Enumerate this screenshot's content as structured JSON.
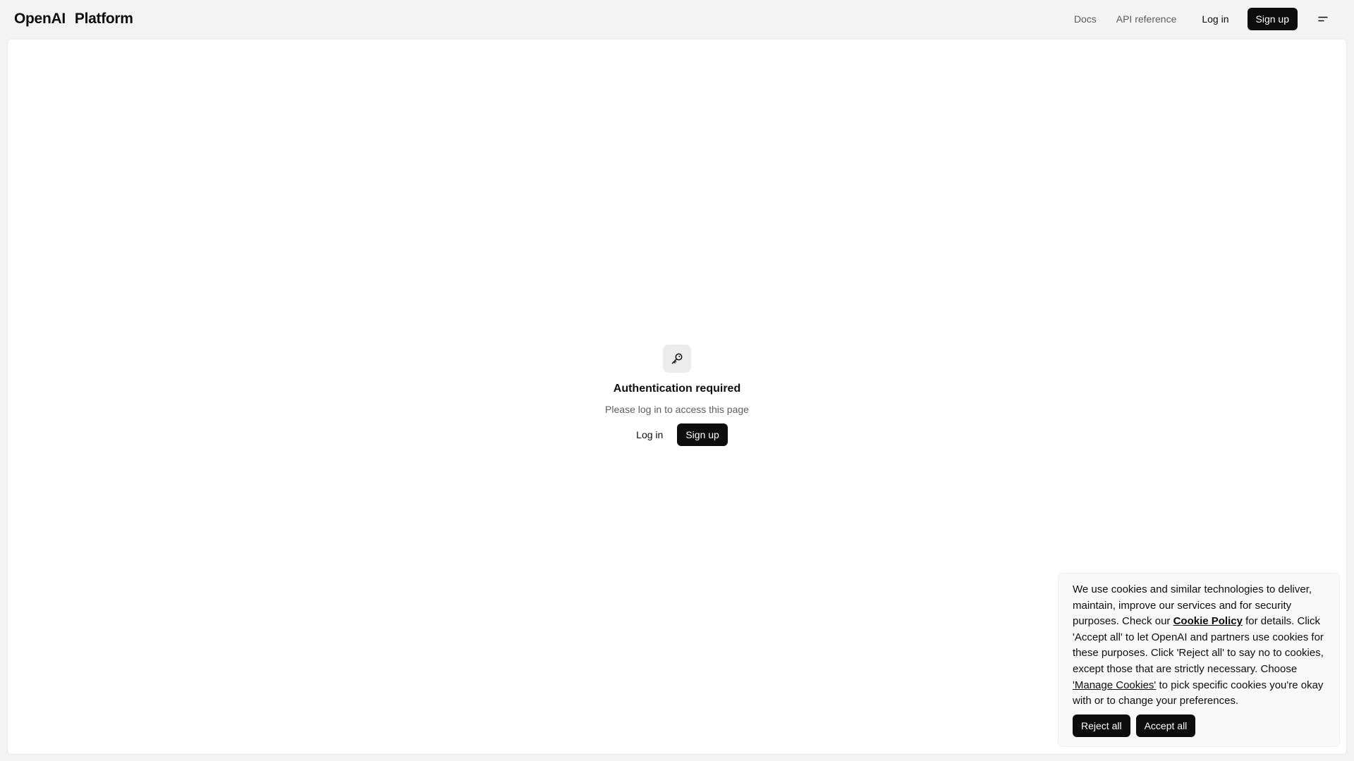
{
  "header": {
    "brand_primary": "OpenAI",
    "brand_secondary": "Platform",
    "nav": {
      "docs": "Docs",
      "api_reference": "API reference"
    },
    "login": "Log in",
    "signup": "Sign up",
    "menu_icon": "menu-icon"
  },
  "auth": {
    "icon": "key-icon",
    "title": "Authentication required",
    "subtitle": "Please log in to access this page",
    "login": "Log in",
    "signup": "Sign up"
  },
  "cookie_banner": {
    "text_1": "We use cookies and similar technologies to deliver, maintain, improve our services and for security purposes. Check our ",
    "policy_link": "Cookie Policy",
    "text_2": " for details. Click 'Accept all' to let OpenAI and partners use cookies for these purposes. Click 'Reject all' to say no to cookies, except those that are strictly necessary. Choose ",
    "manage_link": "'Manage Cookies'",
    "text_3": " to pick specific cookies you're okay with or to change your preferences.",
    "reject": "Reject all",
    "accept": "Accept all"
  },
  "colors": {
    "background": "#f3f3f3",
    "panel": "#ffffff",
    "primary_button": "#0d0d0d",
    "muted_text": "#5d5d5d"
  }
}
